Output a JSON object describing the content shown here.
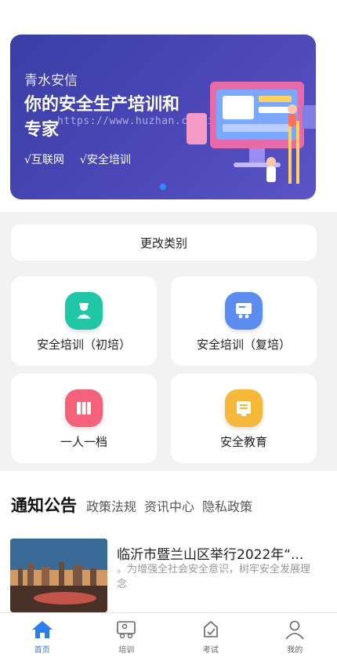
{
  "banner": {
    "brand": "青水安信",
    "title": "你的安全生产培训和专家",
    "tags": [
      "√互联网",
      "√安全培训"
    ],
    "watermark": "https://www.huzhan.com/ishop27186"
  },
  "change_category_label": "更改类别",
  "modules": [
    {
      "label": "安全培训（初培）",
      "icon": "worker-icon",
      "color": "#1fc7a6"
    },
    {
      "label": "安全培训（复培）",
      "icon": "training-board-icon",
      "color": "#5b8cf0"
    },
    {
      "label": "一人一档",
      "icon": "archive-icon",
      "color": "#f6617a"
    },
    {
      "label": "安全教育",
      "icon": "education-icon",
      "color": "#f7b83a"
    }
  ],
  "news": {
    "tabs": [
      "通知公告",
      "政策法规",
      "资讯中心",
      "隐私政策"
    ],
    "items": [
      {
        "title": "临沂市暨兰山区举行2022年“...",
        "desc": "。为增强全社会安全意识，树牢安全发展理念"
      }
    ]
  },
  "tabbar": [
    {
      "label": "首页",
      "icon": "home-icon",
      "active": true
    },
    {
      "label": "培训",
      "icon": "training-icon",
      "active": false
    },
    {
      "label": "考试",
      "icon": "exam-icon",
      "active": false
    },
    {
      "label": "我的",
      "icon": "profile-icon",
      "active": false
    }
  ],
  "colors": {
    "accent": "#2a7ef0",
    "banner": "#4b47b8"
  }
}
